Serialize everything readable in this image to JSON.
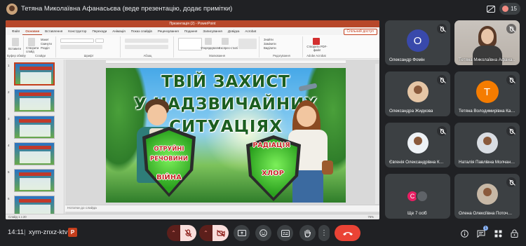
{
  "topbar": {
    "presenter_title": "Тетяна Миколаївна Афанасьєва (веде презентацію, додає примітки)",
    "participants_count": "15"
  },
  "powerpoint": {
    "window_title": "Презентація (2) - PowerPoint",
    "share_button": "Спільний доступ",
    "tabs": [
      "Файл",
      "Основне",
      "Вставлення",
      "Конструктор",
      "Переходи",
      "Анімація",
      "Показ слайдів",
      "Рецензування",
      "Подання",
      "Записування",
      "Довідка",
      "Acrobat"
    ],
    "active_tab": "Основне",
    "ribbon_groups": [
      "Буфер обміну",
      "Слайди",
      "Шрифт",
      "Абзац",
      "Малювання",
      "Редагування",
      "Adobe Acrobat"
    ],
    "ribbon_labels": {
      "paste": "Вставити",
      "new_slide": "Створити слайд",
      "layout": "Макет",
      "reset": "Скинути",
      "section": "Розділ",
      "arrange": "Упорядкувати",
      "quick_styles": "Експрес-стилі",
      "find": "Знайти",
      "replace": "Замінити",
      "select": "Виділити",
      "create_pdf": "Створити PDF-файл"
    },
    "thumbnail_numbers": [
      "1",
      "2",
      "3",
      "4",
      "5",
      "6",
      "7"
    ],
    "notes_placeholder": "Нотатки до слайда",
    "status_left": "Слайд 1 з 20",
    "status_zoom": "76%"
  },
  "slide": {
    "title_lines": [
      "ТВІЙ ЗАХИСТ",
      "У НАДЗВИЧАЙНИХ",
      "СИТУАЦІЯХ"
    ],
    "left_shield_labels": [
      "ОТРУЙНІ",
      "РЕЧОВИНИ",
      "ВІЙНА"
    ],
    "right_shield_labels": [
      "РАДІАЦІЯ",
      "ХЛОР"
    ]
  },
  "tiles": [
    {
      "name": "Олександр Фомін",
      "letter": "О",
      "color": "#3949ab"
    },
    {
      "name": "Тетяна Миколаївна Афана…"
    },
    {
      "name": "Олександра Жидкова"
    },
    {
      "name": "Тетяна Володимирівна Ка…",
      "letter": "Т",
      "color": "#f57c00"
    },
    {
      "name": "Євгенія Олександрівна К…"
    },
    {
      "name": "Наталія Павлівна Молчан…"
    },
    {
      "name": "Ще 7 осіб",
      "letter": "С",
      "color": "#e91e63"
    },
    {
      "name": "Олена Олексіївна Поточ…"
    }
  ],
  "bottombar": {
    "time": "14:11",
    "separator": "|",
    "meeting_code": "xym-znxz-ktv",
    "chat_badge": "1"
  },
  "colors": {
    "meet_background": "#202124",
    "tile_background": "#3c4043",
    "end_call": "#ea4335",
    "muted_control": "#f9dedc",
    "ppt_accent": "#c43e1c"
  }
}
